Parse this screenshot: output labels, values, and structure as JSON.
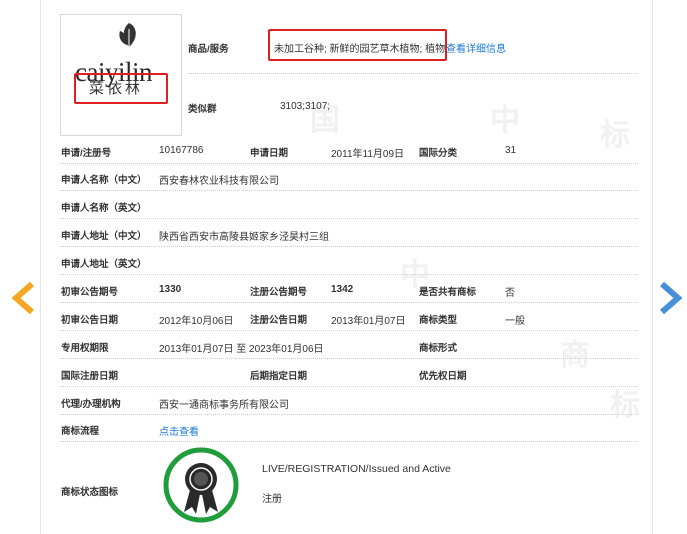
{
  "goods": {
    "label": "商品/服务",
    "value": "未加工谷种; 新鲜的园艺草木植物; 植物;",
    "detail_link": "查看详细信息"
  },
  "similar_group": {
    "label": "类似群",
    "value": "3103;3107;"
  },
  "logo": {
    "text_en": "caiyilin",
    "text_cn": "菜依林"
  },
  "fields": {
    "reg_no": {
      "label": "申请/注册号",
      "value": "10167786"
    },
    "app_date": {
      "label": "申请日期",
      "value": "2011年11月09日"
    },
    "intl_class": {
      "label": "国际分类",
      "value": "31"
    },
    "applicant_cn": {
      "label": "申请人名称（中文）",
      "value": "西安春林农业科技有限公司"
    },
    "applicant_en": {
      "label": "申请人名称（英文）",
      "value": ""
    },
    "address_cn": {
      "label": "申请人地址（中文）",
      "value": "陕西省西安市高陵县姬家乡泾昊村三组"
    },
    "address_en": {
      "label": "申请人地址（英文）",
      "value": ""
    },
    "prelim_no": {
      "label": "初审公告期号",
      "value": "1330"
    },
    "reg_pub_no": {
      "label": "注册公告期号",
      "value": "1342"
    },
    "shared": {
      "label": "是否共有商标",
      "value": "否"
    },
    "prelim_date": {
      "label": "初审公告日期",
      "value": "2012年10月06日"
    },
    "reg_pub_date": {
      "label": "注册公告日期",
      "value": "2013年01月07日"
    },
    "tm_type": {
      "label": "商标类型",
      "value": "一般"
    },
    "exclusive_period": {
      "label": "专用权期限",
      "value": "2013年01月07日 至 2023年01月06日"
    },
    "tm_form": {
      "label": "商标形式",
      "value": ""
    },
    "intl_reg_date": {
      "label": "国际注册日期",
      "value": ""
    },
    "later_date": {
      "label": "后期指定日期",
      "value": ""
    },
    "priority_date": {
      "label": "优先权日期",
      "value": ""
    },
    "agent": {
      "label": "代理/办理机构",
      "value": "西安一通商标事务所有限公司"
    },
    "process": {
      "label": "商标流程",
      "link": "点击查看"
    },
    "status_icon": {
      "label": "商标状态图标",
      "status_en": "LIVE/REGISTRATION/Issued and Active",
      "status_cn": "注册"
    }
  },
  "watermark": [
    "中",
    "国",
    "商",
    "标"
  ],
  "colors": {
    "link": "#1a7ad6",
    "highlight": "#e02020",
    "left_arrow": "#f5a623",
    "right_arrow": "#4a90d9",
    "badge_ring": "#1f9d3a"
  },
  "icons": {
    "prev": "chevron-left-icon",
    "next": "chevron-right-icon",
    "status": "award-badge-icon"
  }
}
